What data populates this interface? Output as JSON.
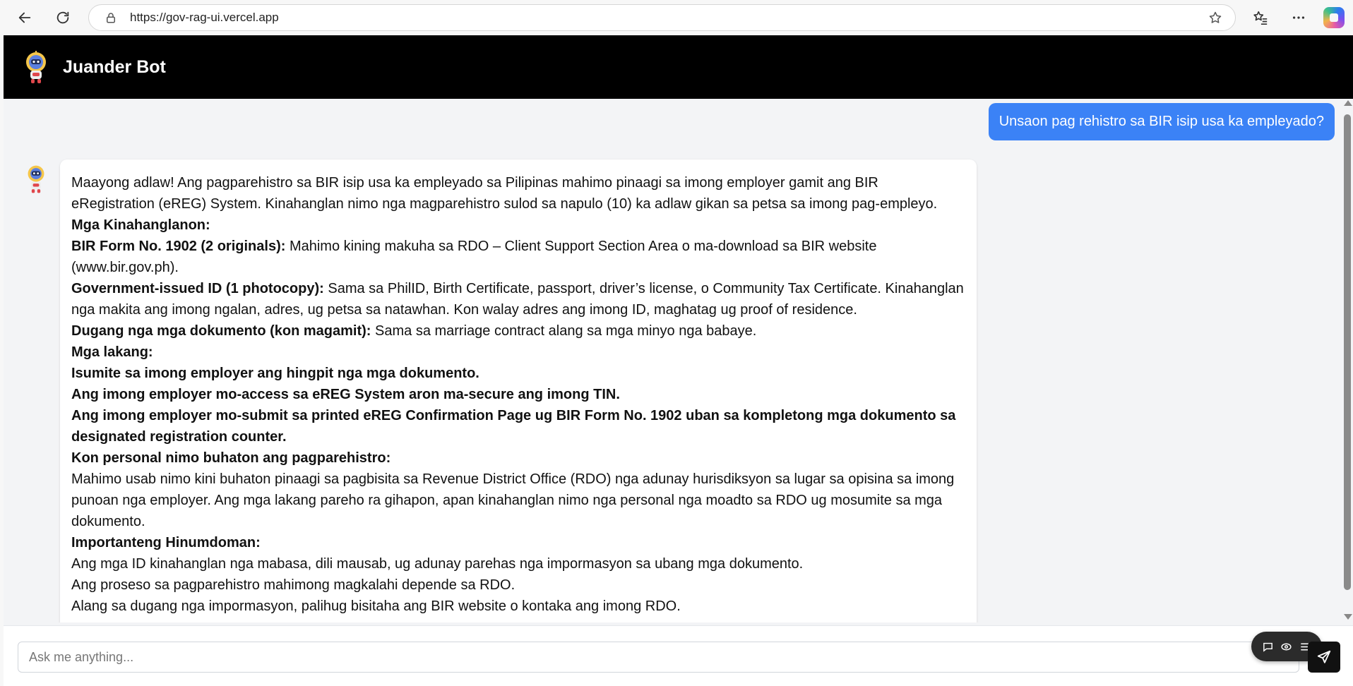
{
  "browser": {
    "url": "https://gov-rag-ui.vercel.app",
    "icons": [
      "back-icon",
      "reload-icon",
      "lock-icon",
      "star-icon",
      "favorites-icon",
      "more-icon",
      "copilot-icon"
    ]
  },
  "app": {
    "title": "Juander Bot",
    "colors": {
      "header": "#000000",
      "user_bubble": "#3b82f6",
      "background": "#f3f4f6",
      "send_button": "#111111"
    }
  },
  "chat": {
    "user_message": "Unsaon pag rehistro sa BIR isip usa ka empleyado?",
    "bot_message": {
      "intro": "Maayong adlaw! Ang pagparehistro sa BIR isip usa ka empleyado sa Pilipinas mahimo pinaagi sa imong employer gamit ang BIR eRegistration (eREG) System. Kinahanglan nimo nga magparehistro sulod sa napulo (10) ka adlaw gikan sa petsa sa imong pag-empleyo.",
      "req_heading": "Mga Kinahanglanon:",
      "req1_bold": "BIR Form No. 1902 (2 originals):",
      "req1_text": " Mahimo kining makuha sa RDO – Client Support Section Area o ma-download sa BIR website (www.bir.gov.ph).",
      "req2_bold": "Government-issued ID (1 photocopy):",
      "req2_text": " Sama sa PhilID, Birth Certificate, passport, driver’s license, o Community Tax Certificate. Kinahanglan nga makita ang imong ngalan, adres, ug petsa sa natawhan. Kon walay adres ang imong ID, maghatag ug proof of residence.",
      "req3_bold": "Dugang nga mga dokumento (kon magamit):",
      "req3_text": " Sama sa marriage contract alang sa mga minyo nga babaye.",
      "steps_heading": "Mga lakang:",
      "step1": "Isumite sa imong employer ang hingpit nga mga dokumento.",
      "step2": "Ang imong employer mo-access sa eREG System aron ma-secure ang imong TIN.",
      "step3": "Ang imong employer mo-submit sa printed eREG Confirmation Page ug BIR Form No. 1902 uban sa kompletong mga dokumento sa designated registration counter.",
      "personal_heading": "Kon personal nimo buhaton ang pagparehistro:",
      "personal_text": "Mahimo usab nimo kini buhaton pinaagi sa pagbisita sa Revenue District Office (RDO) nga adunay hurisdiksyon sa lugar sa opisina sa imong punoan nga employer. Ang mga lakang pareho ra gihapon, apan kinahanglan nimo nga personal nga moadto sa RDO ug mosumite sa mga dokumento.",
      "notes_heading": "Importanteng Hinumdoman:",
      "note1": "Ang mga ID kinahanglan nga mabasa, dili mausab, ug adunay parehas nga impormasyon sa ubang mga dokumento.",
      "note2": "Ang proseso sa pagparehistro mahimong magkalahi depende sa RDO.",
      "note3": "Alang sa dugang nga impormasyon, palihug bisitaha ang BIR website o kontaka ang imong RDO."
    }
  },
  "composer": {
    "placeholder": "Ask me anything...",
    "send_icon": "send-icon",
    "tool_icons": [
      "chat-icon",
      "eye-icon",
      "list-icon"
    ]
  }
}
